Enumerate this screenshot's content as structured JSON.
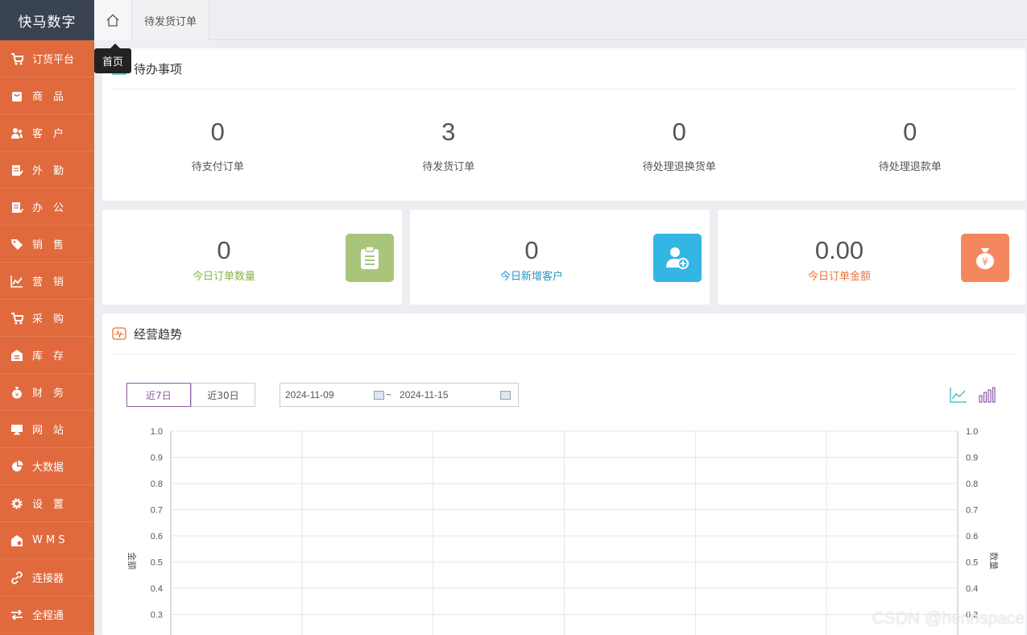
{
  "app": {
    "logo": "快马数字"
  },
  "sidebar": {
    "items": [
      {
        "label": "订货平台",
        "icon": "cart-icon"
      },
      {
        "label": "商　品",
        "icon": "bag-icon"
      },
      {
        "label": "客　户",
        "icon": "users-icon"
      },
      {
        "label": "外　勤",
        "icon": "clipboard-edit-icon"
      },
      {
        "label": "办　公",
        "icon": "clipboard-check-icon"
      },
      {
        "label": "销　售",
        "icon": "tag-icon"
      },
      {
        "label": "营　销",
        "icon": "line-chart-icon"
      },
      {
        "label": "采　购",
        "icon": "cart-icon"
      },
      {
        "label": "库　存",
        "icon": "warehouse-icon"
      },
      {
        "label": "财　务",
        "icon": "money-bag-icon"
      },
      {
        "label": "网　站",
        "icon": "monitor-icon"
      },
      {
        "label": "大数据",
        "icon": "pie-chart-icon"
      },
      {
        "label": "设　置",
        "icon": "gear-icon"
      },
      {
        "label": "W M S",
        "icon": "wms-icon"
      },
      {
        "label": "连接器",
        "icon": "link-icon"
      },
      {
        "label": "全程通",
        "icon": "swap-icon"
      }
    ]
  },
  "tabs": {
    "home_tooltip": "首页",
    "items": [
      {
        "label": "待发货订单"
      }
    ]
  },
  "todo": {
    "title": "待办事项",
    "items": [
      {
        "value": "0",
        "label": "待支付订单"
      },
      {
        "value": "3",
        "label": "待发货订单"
      },
      {
        "value": "0",
        "label": "待处理退换货单"
      },
      {
        "value": "0",
        "label": "待处理退款单"
      }
    ]
  },
  "stats": [
    {
      "value": "0",
      "label": "今日订单数量",
      "color": "#8bb24b",
      "badge_color": "#a9c57c",
      "icon": "clipboard-icon"
    },
    {
      "value": "0",
      "label": "今日新增客户",
      "color": "#2596be",
      "badge_color": "#33b6e4",
      "icon": "add-user-icon"
    },
    {
      "value": "0.00",
      "label": "今日订单金额",
      "color": "#e8743b",
      "badge_color": "#f5875f",
      "icon": "money-bag-icon"
    }
  ],
  "trend": {
    "title": "经营趋势",
    "ranges": [
      {
        "label": "近7日",
        "active": true
      },
      {
        "label": "近30日",
        "active": false
      }
    ],
    "date_start": "2024-11-09",
    "date_sep": "~",
    "date_end": "2024-11-15"
  },
  "chart_data": {
    "type": "line",
    "title": "",
    "ylabel": "金额",
    "y2label": "数量",
    "ylim": [
      0,
      1
    ],
    "y2lim": [
      0,
      1
    ],
    "y_ticks": [
      "1.0",
      "0.9",
      "0.8",
      "0.7",
      "0.6",
      "0.5",
      "0.4",
      "0.3"
    ],
    "y2_ticks": [
      "1.0",
      "0.9",
      "0.8",
      "0.7",
      "0.6",
      "0.5",
      "0.4",
      "0.3"
    ],
    "categories": [],
    "series": [],
    "grid": true
  },
  "watermark": "CSDN @herinspace"
}
